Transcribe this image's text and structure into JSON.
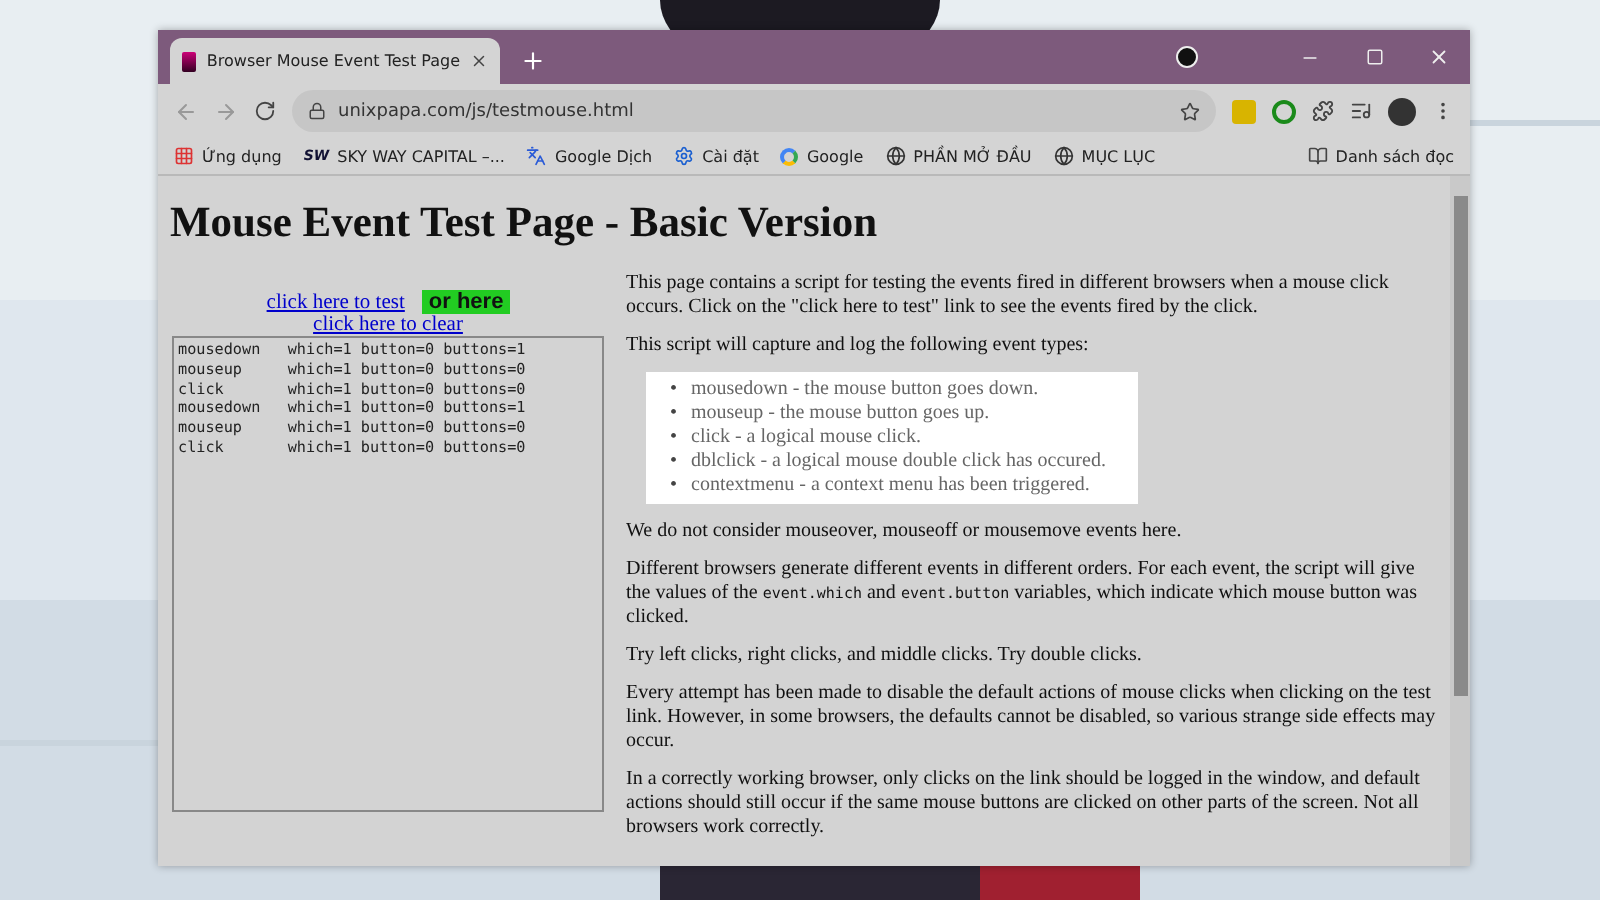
{
  "browser": {
    "tab": {
      "title": "Browser Mouse Event Test Page",
      "selected": true
    },
    "url": "unixpapa.com/js/testmouse.html",
    "bookmarks": [
      {
        "label": "Ứng dụng",
        "kind": "apps"
      },
      {
        "label": "SKY WAY CAPITAL –...",
        "kind": "sw",
        "logo_text": "SW"
      },
      {
        "label": "Google Dịch",
        "kind": "translate"
      },
      {
        "label": "Cài đặt",
        "kind": "gear"
      },
      {
        "label": "Google",
        "kind": "google"
      },
      {
        "label": "PHẦN MỞ ĐẦU",
        "kind": "globe"
      },
      {
        "label": "MỤC LỤC",
        "kind": "globe"
      }
    ],
    "reading_list": "Danh sách đọc"
  },
  "page": {
    "heading": "Mouse Event Test Page - Basic Version",
    "test_link": "click here to test",
    "or_here": "or here",
    "clear_link": "click here to clear",
    "log": [
      "mousedown   which=1 button=0 buttons=1",
      "mouseup     which=1 button=0 buttons=0",
      "click       which=1 button=0 buttons=0",
      "mousedown   which=1 button=0 buttons=1",
      "mouseup     which=1 button=0 buttons=0",
      "click       which=1 button=0 buttons=0"
    ],
    "intro": "This page contains a script for testing the events fired in different browsers when a mouse click occurs. Click on the \"click here to test\" link to see the events fired by the click.",
    "list_intro": "This script will capture and log the following event types:",
    "event_types": [
      {
        "marker": "•",
        "text": "mousedown - the mouse button goes down."
      },
      {
        "marker": "•",
        "text": "mouseup - the mouse button goes up."
      },
      {
        "marker": "•",
        "text": "click - a logical mouse click."
      },
      {
        "marker": "•",
        "text": "dblclick - a logical mouse double click has occured."
      },
      {
        "marker": "•",
        "text": "contextmenu - a context menu has been triggered."
      }
    ],
    "paragraphs": [
      [
        {
          "kind": "text",
          "text": "We do not consider mouseover, mouseoff or mousemove events here."
        }
      ],
      [
        {
          "kind": "text",
          "text": "Different browsers generate different events in different orders. For each event, the script will give the values of the "
        },
        {
          "kind": "code",
          "text": "event.which"
        },
        {
          "kind": "text",
          "text": " and "
        },
        {
          "kind": "code",
          "text": "event.button"
        },
        {
          "kind": "text",
          "text": " variables, which indicate which mouse button was clicked."
        }
      ],
      [
        {
          "kind": "text",
          "text": "Try left clicks, right clicks, and middle clicks. Try double clicks."
        }
      ],
      [
        {
          "kind": "text",
          "text": "Every attempt has been made to disable the default actions of mouse clicks when clicking on the test link. However, in some browsers, the defaults cannot be disabled, so various strange side effects may occur."
        }
      ],
      [
        {
          "kind": "text",
          "text": "In a correctly working browser, only clicks on the link should be logged in the window, and default actions should still occur if the same mouse buttons are clicked on other parts of the screen. Not all browsers work correctly."
        }
      ]
    ]
  }
}
